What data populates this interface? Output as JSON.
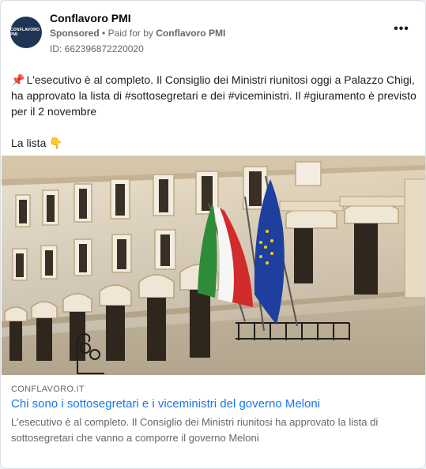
{
  "header": {
    "avatar_text": "CONFLAVORO PMI",
    "page_name": "Conflavoro PMI",
    "sponsored": "Sponsored",
    "separator": "•",
    "paid_for_prefix": "Paid for by",
    "paid_for_name": "Conflavoro PMI",
    "ad_id": "ID: 662396872220020",
    "more_icon": "more-horizontal-icon",
    "more_label": "•••"
  },
  "post": {
    "pin_icon": "📌",
    "line1": "L'esecutivo è al completo. Il Consiglio dei Ministri riunitosi oggi a Palazzo Chigi, ha approvato la lista di #sottosegretari e dei #viceministri. Il #giuramento è previsto per il 2 novembre",
    "line2": "La lista",
    "hand_icon": "👇"
  },
  "link": {
    "domain": "CONFLAVORO.IT",
    "headline": "Chi sono i sottosegretari e i viceministri del governo Meloni",
    "description": "L'esecutivo è al completo. Il Consiglio dei Ministri riunitosi ha approvato la lista di sottosegretari che vanno a comporre il governo Meloni"
  },
  "colors": {
    "link_blue": "#1877f2",
    "muted_text": "#65676b",
    "facade": "#e8dcc6",
    "italy_green": "#2e8b3a",
    "italy_red": "#d22b2b",
    "eu_blue": "#1f3f9e",
    "eu_star": "#f5d000"
  }
}
